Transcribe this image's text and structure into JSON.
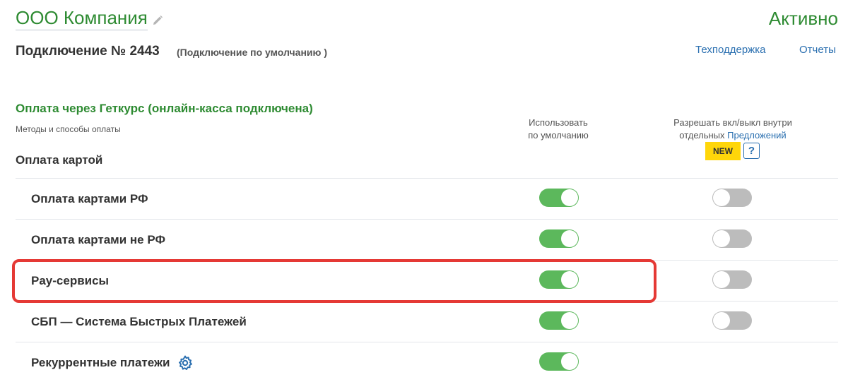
{
  "header": {
    "company_name": "ООО Компания",
    "status": "Активно",
    "connection_title": "Подключение № 2443",
    "connection_subtitle": "(Подключение по умолчанию )",
    "link_support": "Техподдержка",
    "link_reports": "Отчеты"
  },
  "section": {
    "title": "Оплата через Геткурс (онлайн-касса подключена)",
    "subtitle": "Методы и способы оплаты",
    "group_title": "Оплата картой",
    "col_default_line1": "Использовать",
    "col_default_line2": "по умолчанию",
    "col_allow_line1": "Разрешать вкл/выкл внутри",
    "col_allow_line2_prefix": "отдельных ",
    "col_allow_line2_link": "Предложений",
    "badge_new": "NEW",
    "help": "?"
  },
  "rows": [
    {
      "label": "Оплата картами РФ",
      "default_on": true,
      "allow_on": false
    },
    {
      "label": "Оплата картами не РФ",
      "default_on": true,
      "allow_on": false
    },
    {
      "label": "Pay-сервисы",
      "default_on": true,
      "allow_on": false,
      "highlighted": true
    },
    {
      "label": "СБП — Система Быстрых Платежей",
      "default_on": true,
      "allow_on": false
    },
    {
      "label": "Рекуррентные платежи",
      "default_on": true,
      "icon": "gear-icon"
    }
  ],
  "colors": {
    "accent_green": "#2e8b32",
    "toggle_on": "#5cb85c",
    "toggle_off": "#bcbcbc",
    "link_blue": "#2a6fb0",
    "badge_yellow": "#ffd60a",
    "highlight_red": "#e53935"
  }
}
